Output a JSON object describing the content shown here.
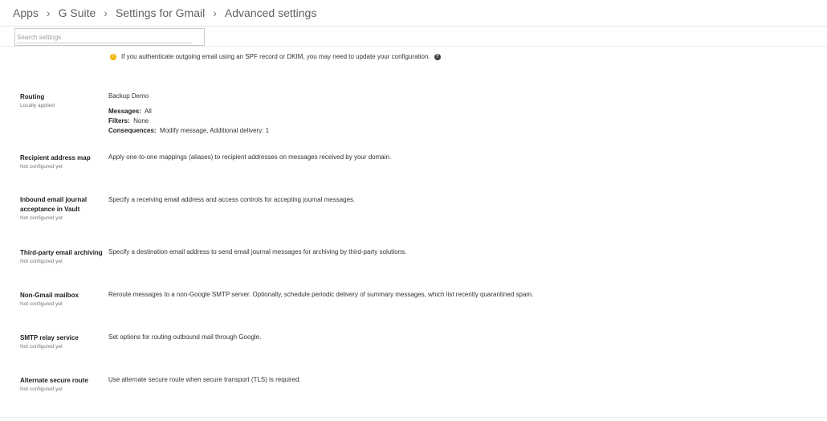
{
  "breadcrumb": [
    "Apps",
    "G Suite",
    "Settings for Gmail",
    "Advanced settings"
  ],
  "search": {
    "placeholder": "Search settings"
  },
  "notice": {
    "text": "If you authenticate outgoing email using an SPF record or DKIM, you may need to update your configuration."
  },
  "routing": {
    "name": "Routing",
    "status": "Locally applied",
    "rule_name": "Backup Demo",
    "messages_label": "Messages:",
    "messages_value": "All",
    "filters_label": "Filters:",
    "filters_value": "None",
    "consequences_label": "Consequences:",
    "consequences_value": "Modify message, Additional delivery: 1"
  },
  "settings": [
    {
      "name": "Recipient address map",
      "status": "Not configured yet",
      "description": "Apply one-to-one mappings (aliases) to recipient addresses on messages received by your domain."
    },
    {
      "name": "Inbound email journal acceptance in Vault",
      "status": "Not configured yet",
      "description": "Specify a receiving email address and access controls for accepting journal messages."
    },
    {
      "name": "Third-party email archiving",
      "status": "Not configured yet",
      "description": "Specify a destination email address to send email journal messages for archiving by third-party solutions."
    },
    {
      "name": "Non-Gmail mailbox",
      "status": "Not configured yet",
      "description": "Reroute messages to a non-Google SMTP server. Optionally, schedule periodic delivery of summary messages, which list recently quarantined spam."
    },
    {
      "name": "SMTP relay service",
      "status": "Not configured yet",
      "description": "Set options for routing outbound mail through Google."
    },
    {
      "name": "Alternate secure route",
      "status": "Not configured yet",
      "description": "Use alternate secure route when secure transport (TLS) is required."
    }
  ]
}
